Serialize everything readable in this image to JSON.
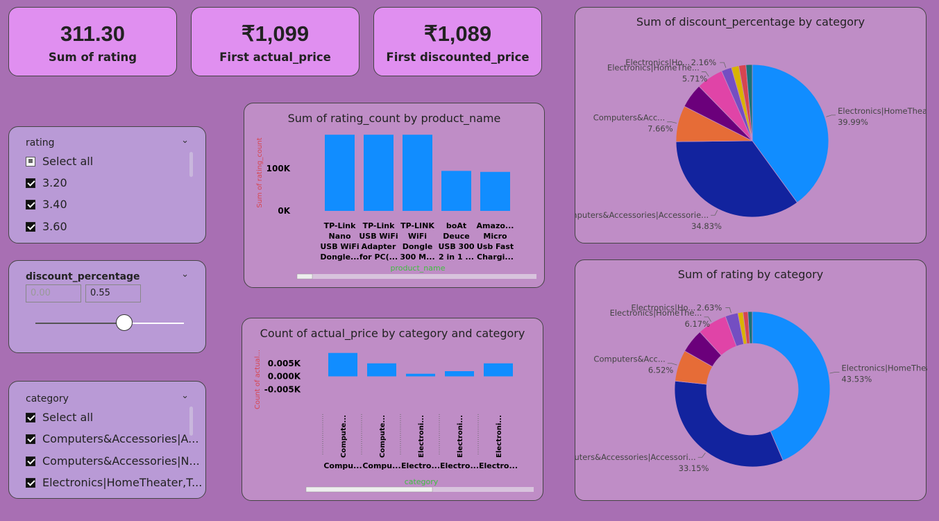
{
  "kpis": [
    {
      "value": "311.30",
      "label": "Sum of rating"
    },
    {
      "value": "₹1,099",
      "label": "First actual_price"
    },
    {
      "value": "₹1,089",
      "label": "First discounted_price"
    }
  ],
  "slicers": {
    "rating": {
      "title": "rating",
      "items": [
        {
          "label": "Select all",
          "state": "partial"
        },
        {
          "label": "3.20",
          "state": "checked"
        },
        {
          "label": "3.40",
          "state": "checked"
        },
        {
          "label": "3.60",
          "state": "checked"
        }
      ]
    },
    "discount": {
      "title": "discount_percentage",
      "min_value": "0.00",
      "max_value": "0.55",
      "slider_fraction": 0.6
    },
    "category": {
      "title": "category",
      "items": [
        {
          "label": "Select all",
          "state": "checked"
        },
        {
          "label": "Computers&Accessories|A...",
          "state": "checked"
        },
        {
          "label": "Computers&Accessories|N...",
          "state": "checked"
        },
        {
          "label": "Electronics|HomeTheater,T...",
          "state": "checked"
        }
      ]
    }
  },
  "chart_data": [
    {
      "type": "bar",
      "title": "Sum of rating_count by product_name",
      "xlabel": "product_name",
      "ylabel": "Sum of rating_count",
      "yticks": [
        "0K",
        "100K"
      ],
      "ylim": [
        0,
        180000
      ],
      "categories": [
        [
          "TP-Link",
          "Nano",
          "USB WiFi",
          "Dongle..."
        ],
        [
          "TP-Link",
          "USB WiFi",
          "Adapter",
          "for PC(..."
        ],
        [
          "TP-LINK",
          "WiFi",
          "Dongle",
          "300 M..."
        ],
        [
          "boAt",
          "Deuce",
          "USB 300",
          "2 in 1 ..."
        ],
        [
          "Amazo...",
          "Micro",
          "Usb Fast",
          "Chargi..."
        ]
      ],
      "values": [
        179691,
        179691,
        179691,
        94363,
        92000
      ],
      "color": "#118dff"
    },
    {
      "type": "bar",
      "title": "Count of actual_price by category and category",
      "xlabel": "category",
      "ylabel": "Count of actual...",
      "yticks": [
        "-0.005K",
        "0.000K",
        "0.005K"
      ],
      "ylim": [
        -0.01,
        0.01
      ],
      "categories_inner": [
        "Compute...",
        "Compute...",
        "Electroni...",
        "Electroni...",
        "Electroni..."
      ],
      "categories_outer": [
        "Compu...",
        "Compu...",
        "Electro...",
        "Electro...",
        "Electro..."
      ],
      "values": [
        0.009,
        0.005,
        0.001,
        0.002,
        0.005
      ],
      "color": "#118dff"
    },
    {
      "type": "pie",
      "title": "Sum of discount_percentage by category",
      "slices": [
        {
          "label": "Electronics|HomeTheate...",
          "value": 39.99,
          "pct": "39.99%",
          "color": "#118dff"
        },
        {
          "label": "Computers&Accessories|Accessorie...",
          "value": 34.83,
          "pct": "34.83%",
          "color": "#12239e"
        },
        {
          "label": "Computers&Acc...",
          "value": 7.66,
          "pct": "7.66%",
          "color": "#e66c37"
        },
        {
          "label": "",
          "value": 5.2,
          "pct": "",
          "color": "#6b007b"
        },
        {
          "label": "Electronics|HomeThe...",
          "value": 5.71,
          "pct": "5.71%",
          "color": "#e044a7"
        },
        {
          "label": "Electronics|Ho...",
          "value": 2.16,
          "pct": "2.16%",
          "color": "#744ec2"
        },
        {
          "label": "",
          "value": 1.6,
          "pct": "",
          "color": "#d9b300"
        },
        {
          "label": "",
          "value": 1.5,
          "pct": "",
          "color": "#d64550"
        },
        {
          "label": "",
          "value": 1.34,
          "pct": "",
          "color": "#197278"
        }
      ]
    },
    {
      "type": "pie",
      "title": "Sum of rating by category",
      "slices": [
        {
          "label": "Electronics|HomeTheat...",
          "value": 43.53,
          "pct": "43.53%",
          "color": "#118dff"
        },
        {
          "label": "Computers&Accessories|Accessori...",
          "value": 33.15,
          "pct": "33.15%",
          "color": "#12239e"
        },
        {
          "label": "Computers&Acc...",
          "value": 6.52,
          "pct": "6.52%",
          "color": "#e66c37"
        },
        {
          "label": "",
          "value": 5.0,
          "pct": "",
          "color": "#6b007b"
        },
        {
          "label": "Electronics|HomeThe...",
          "value": 6.17,
          "pct": "6.17%",
          "color": "#e044a7"
        },
        {
          "label": "Electronics|Ho...",
          "value": 2.63,
          "pct": "2.63%",
          "color": "#744ec2"
        },
        {
          "label": "",
          "value": 1.1,
          "pct": "",
          "color": "#d9b300"
        },
        {
          "label": "",
          "value": 1.0,
          "pct": "",
          "color": "#d64550"
        },
        {
          "label": "",
          "value": 0.9,
          "pct": "",
          "color": "#197278"
        }
      ]
    }
  ]
}
